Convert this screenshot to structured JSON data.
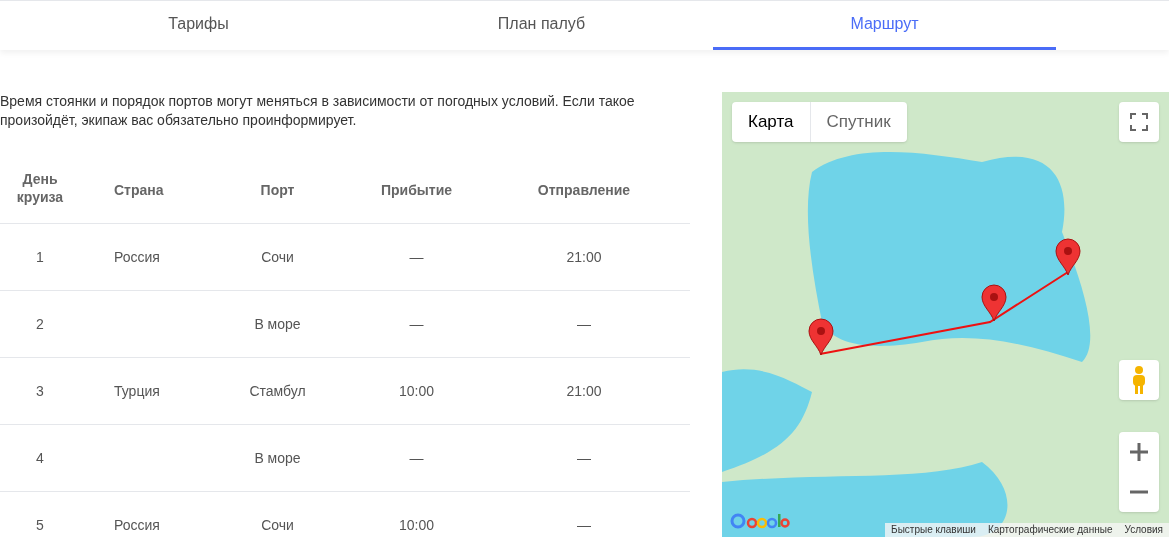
{
  "tabs": [
    {
      "label": "Тарифы",
      "selected": false
    },
    {
      "label": "План палуб",
      "selected": false
    },
    {
      "label": "Маршрут",
      "selected": true
    }
  ],
  "notice": "Время стоянки и порядок портов могут меняться в зависимости от погодных условий. Если такое произойдёт, экипаж вас обязательно проинформирует.",
  "table": {
    "columns": [
      "День круиза",
      "Страна",
      "Порт",
      "Прибытие",
      "Отправление"
    ],
    "rows": [
      [
        "1",
        "Россия",
        "Сочи",
        "—",
        "21:00"
      ],
      [
        "2",
        "",
        "В море",
        "—",
        "—"
      ],
      [
        "3",
        "Турция",
        "Стамбул",
        "10:00",
        "21:00"
      ],
      [
        "4",
        "",
        "В море",
        "—",
        "—"
      ],
      [
        "5",
        "Россия",
        "Сочи",
        "10:00",
        "—"
      ]
    ]
  },
  "map": {
    "map_types": [
      {
        "label": "Карта",
        "selected": true
      },
      {
        "label": "Спутник",
        "selected": false
      }
    ],
    "footer": [
      "Быстрые клавиши",
      "Картографические данные",
      "Условия"
    ]
  }
}
